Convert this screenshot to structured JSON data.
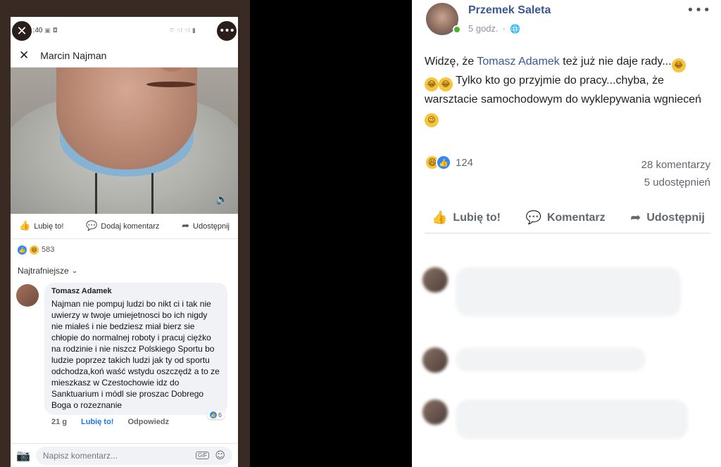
{
  "phone": {
    "status_time": "0:40",
    "status_icons": "▣ ◘",
    "status_right": "⌔ ⁖⁝ ⁖⁝ ▮",
    "close_glyph": "✕",
    "more_glyph": "•••",
    "header_close": "✕",
    "header_name": "Marcin Najman",
    "actions": {
      "like": "Lubię to!",
      "comment": "Dodaj komentarz",
      "share": "Udostępnij"
    },
    "reactions_count": "583",
    "sort_label": "Najtrafniejsze",
    "comment": {
      "author": "Tomasz Adamek",
      "text": "Najman nie pompuj ludzi bo nikt ci i tak nie uwierzy w twoje umiejetnosci bo ich nigdy nie miałeś i nie bedziesz miał bierz sie chłopie do normalnej roboty i pracuj ciężko na rodzinie i nie niszcz Polskiego Sportu bo ludzie poprzez takich ludzi jak ty od sportu odchodza,koń waść wstydu oszczędź a to ze mieszkasz w Czestochowie idz do Sanktuarium i módl sie proszac Dobrego Boga o rozeznanie",
      "likes": "6",
      "time": "21 g",
      "like_label": "Lubię to!",
      "reply_label": "Odpowiedz"
    },
    "input_placeholder": "Napisz komentarz...",
    "gif_label": "GIF"
  },
  "post": {
    "author": "Przemek Saleta",
    "time": "5 godz.",
    "more_glyph": "•••",
    "text_before": "Widzę, że ",
    "mention": "Tomasz Adamek",
    "text_after1": " też już nie daje rady...",
    "text_after2": " Tylko kto go przyjmie do pracy...chyba, że warsztacie samochodowym do wyklepywania wgnieceń ",
    "reactions_count": "124",
    "comments_count": "28 komentarzy",
    "shares_count": "5 udostępnień",
    "actions": {
      "like": "Lubię to!",
      "comment": "Komentarz",
      "share": "Udostępnij"
    }
  },
  "colors": {
    "link": "#385898",
    "facebook_blue": "#1877f2",
    "online": "#42b72a"
  }
}
